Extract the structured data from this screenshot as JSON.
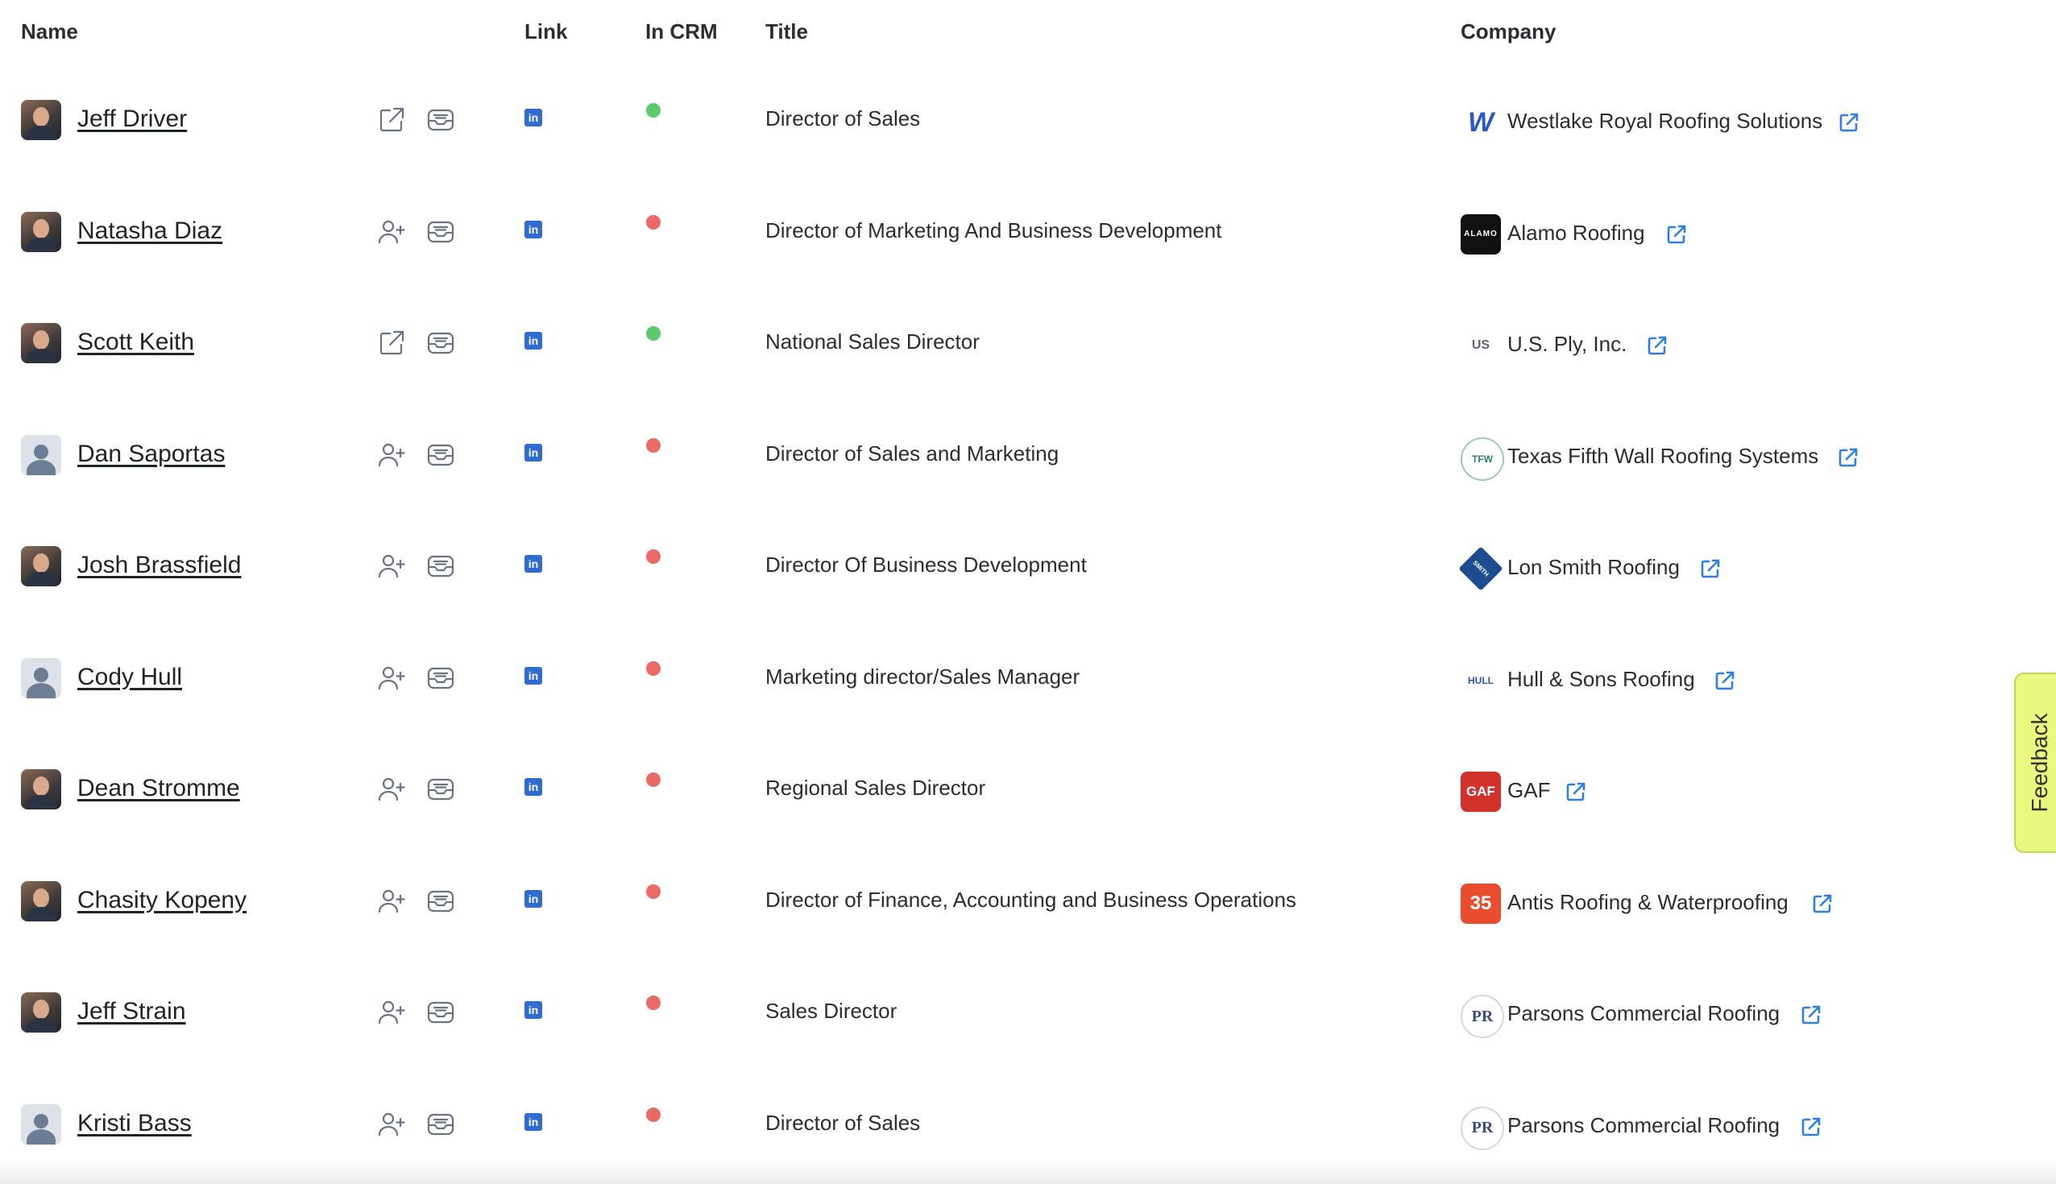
{
  "columns": {
    "name": "Name",
    "link": "Link",
    "in_crm": "In CRM",
    "title": "Title",
    "company": "Company"
  },
  "colors": {
    "in_crm_yes": "#5cc96c",
    "in_crm_no": "#ea6b66",
    "link_blue": "#2f6bd0",
    "feedback_bg": "#e9f87e"
  },
  "feedback_label": "Feedback",
  "rows": [
    {
      "name": "Jeff Driver",
      "avatar": "photo",
      "action_icon": "external-edit-icon",
      "in_crm": true,
      "title": "Director of Sales",
      "company": "Westlake Royal Roofing Solutions",
      "company_logo": "W"
    },
    {
      "name": "Natasha Diaz",
      "avatar": "photo",
      "action_icon": "add-person-icon",
      "in_crm": false,
      "title": "Director of Marketing And Business Development",
      "company": "Alamo Roofing",
      "company_logo": "ALAMO"
    },
    {
      "name": "Scott Keith",
      "avatar": "photo",
      "action_icon": "external-edit-icon",
      "in_crm": true,
      "title": "National Sales Director",
      "company": "U.S. Ply, Inc.",
      "company_logo": "US"
    },
    {
      "name": "Dan Saportas",
      "avatar": "default",
      "action_icon": "add-person-icon",
      "in_crm": false,
      "title": "Director of Sales and Marketing",
      "company": "Texas Fifth Wall Roofing Systems",
      "company_logo": "TFW"
    },
    {
      "name": "Josh Brassfield",
      "avatar": "photo",
      "action_icon": "add-person-icon",
      "in_crm": false,
      "title": "Director Of Business Development",
      "company": "Lon Smith Roofing",
      "company_logo": "SMITH"
    },
    {
      "name": "Cody Hull",
      "avatar": "default",
      "action_icon": "add-person-icon",
      "in_crm": false,
      "title": "Marketing director/Sales Manager",
      "company": "Hull & Sons Roofing",
      "company_logo": "HULL"
    },
    {
      "name": "Dean Stromme",
      "avatar": "photo",
      "action_icon": "add-person-icon",
      "in_crm": false,
      "title": "Regional Sales Director",
      "company": "GAF",
      "company_logo": "GAF"
    },
    {
      "name": "Chasity Kopeny",
      "avatar": "photo",
      "action_icon": "add-person-icon",
      "in_crm": false,
      "title": "Director of Finance, Accounting and Business Operations",
      "company": "Antis Roofing & Waterproofing",
      "company_logo": "35"
    },
    {
      "name": "Jeff Strain",
      "avatar": "photo",
      "action_icon": "add-person-icon",
      "in_crm": false,
      "title": "Sales Director",
      "company": "Parsons Commercial Roofing",
      "company_logo": "PR"
    },
    {
      "name": "Kristi Bass",
      "avatar": "default",
      "action_icon": "add-person-icon",
      "in_crm": false,
      "title": "Director of Sales",
      "company": "Parsons Commercial Roofing",
      "company_logo": "PR"
    }
  ]
}
